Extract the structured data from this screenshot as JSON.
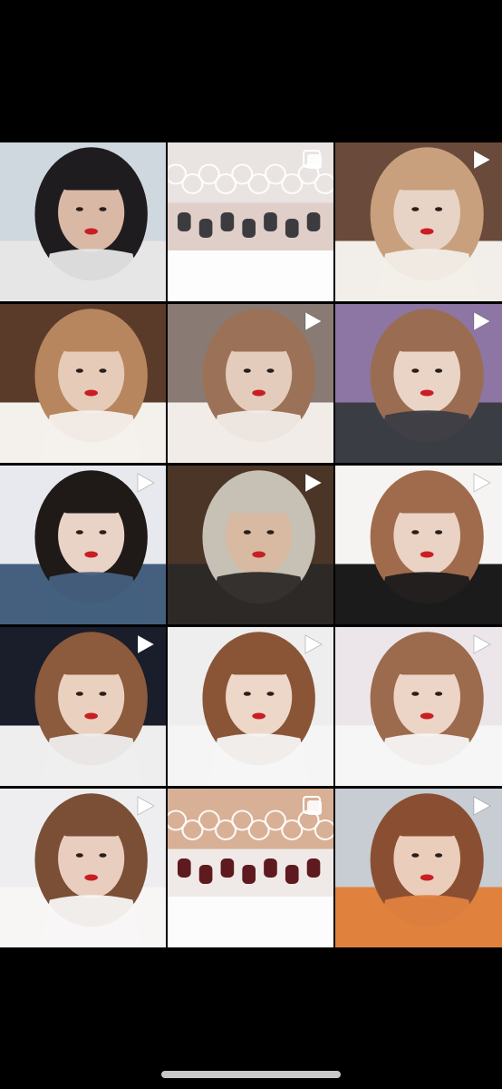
{
  "app": "photo-grid",
  "tiles": [
    {
      "id": "t1",
      "kind": "photo",
      "scene": "portrait-dark-top",
      "colors": [
        "#cfd8de",
        "#e6e6e6",
        "#1f1c1f",
        "#d9b9a6"
      ]
    },
    {
      "id": "t2",
      "kind": "gallery",
      "scene": "lace-toes",
      "colors": [
        "#f5f3f3",
        "#e9e3e2",
        "#3c3c40",
        "#dcc8c0"
      ]
    },
    {
      "id": "t3",
      "kind": "video",
      "scene": "headphones-white-top",
      "colors": [
        "#6a4a3a",
        "#f2eee9",
        "#c9a07d",
        "#e8d4c6"
      ]
    },
    {
      "id": "t4",
      "kind": "photo",
      "scene": "headphones-room",
      "colors": [
        "#5a3b2a",
        "#f4f0ec",
        "#b7865e",
        "#e5cbb8"
      ]
    },
    {
      "id": "t5",
      "kind": "video",
      "scene": "selfie-bed",
      "colors": [
        "#8a7a74",
        "#f1ece8",
        "#9b7257",
        "#e4ccbd"
      ]
    },
    {
      "id": "t6",
      "kind": "video",
      "scene": "denim-jacket",
      "colors": [
        "#8d76a4",
        "#3b3d45",
        "#9a6d52",
        "#ead4c6"
      ]
    },
    {
      "id": "t7",
      "kind": "video",
      "scene": "bed-blanket",
      "colors": [
        "#e8e9ee",
        "#45607f",
        "#1f1a18",
        "#e9d2c6"
      ]
    },
    {
      "id": "t8",
      "kind": "video",
      "scene": "wine-glass",
      "colors": [
        "#4a3526",
        "#2c2927",
        "#c7c0b5",
        "#d8b9a2"
      ]
    },
    {
      "id": "t9",
      "kind": "video",
      "scene": "striped-shirt",
      "colors": [
        "#f6f4f2",
        "#1b1b1b",
        "#a06b4c",
        "#ead2c4"
      ]
    },
    {
      "id": "t10",
      "kind": "video",
      "scene": "city-night",
      "colors": [
        "#1a1d2a",
        "#eeeeee",
        "#8c5a3c",
        "#ead0bf"
      ]
    },
    {
      "id": "t11",
      "kind": "video",
      "scene": "graphic-tee",
      "colors": [
        "#eeeeee",
        "#f5f5f5",
        "#8a5536",
        "#edd7c9"
      ]
    },
    {
      "id": "t12",
      "kind": "video",
      "scene": "lying-down",
      "colors": [
        "#ece6ea",
        "#f6f6f6",
        "#9c6a4c",
        "#ecd4c6"
      ]
    },
    {
      "id": "t13",
      "kind": "video",
      "scene": "striped-tee",
      "colors": [
        "#eeeef0",
        "#f8f5f5",
        "#7a4f36",
        "#e9cebf"
      ]
    },
    {
      "id": "t14",
      "kind": "gallery",
      "scene": "nails-lace",
      "colors": [
        "#f4f1f0",
        "#d8b095",
        "#5e1a1e",
        "#ede9e6"
      ]
    },
    {
      "id": "t15",
      "kind": "video",
      "scene": "orange-top",
      "colors": [
        "#c7cdd3",
        "#e0813e",
        "#8a4f32",
        "#ebcdbc"
      ]
    }
  ]
}
